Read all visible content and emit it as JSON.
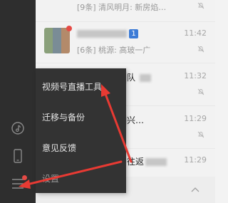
{
  "sidebar": {
    "icons": [
      "music-icon",
      "phone-icon",
      "menu-icon"
    ]
  },
  "chat_list": {
    "rows": [
      {
        "title": "",
        "subtitle": "[9条] 清风明月: 新房焰…",
        "time": "",
        "muted": true
      },
      {
        "title": "",
        "badge": "1",
        "subtitle": "[6条] 桃源: 高玻一广",
        "time": "11:42",
        "muted": true
      },
      {
        "title": "队",
        "subtitle": "怡: 报…",
        "time": "11:32",
        "muted": true
      },
      {
        "title": "兴…",
        "subtitle": "小伙子…",
        "time": "11:29",
        "muted": true
      },
      {
        "title": "往返",
        "subtitle": "",
        "time": "11:29",
        "muted": false
      }
    ]
  },
  "popup_menu": {
    "items": [
      "视频号直播工具",
      "迁移与备份",
      "意见反馈",
      "设置"
    ]
  },
  "colors": {
    "sidebar_bg": "#2e2e2e",
    "popup_bg": "#333333",
    "arrow": "#e83a33",
    "unread_dot": "#e64a45"
  }
}
